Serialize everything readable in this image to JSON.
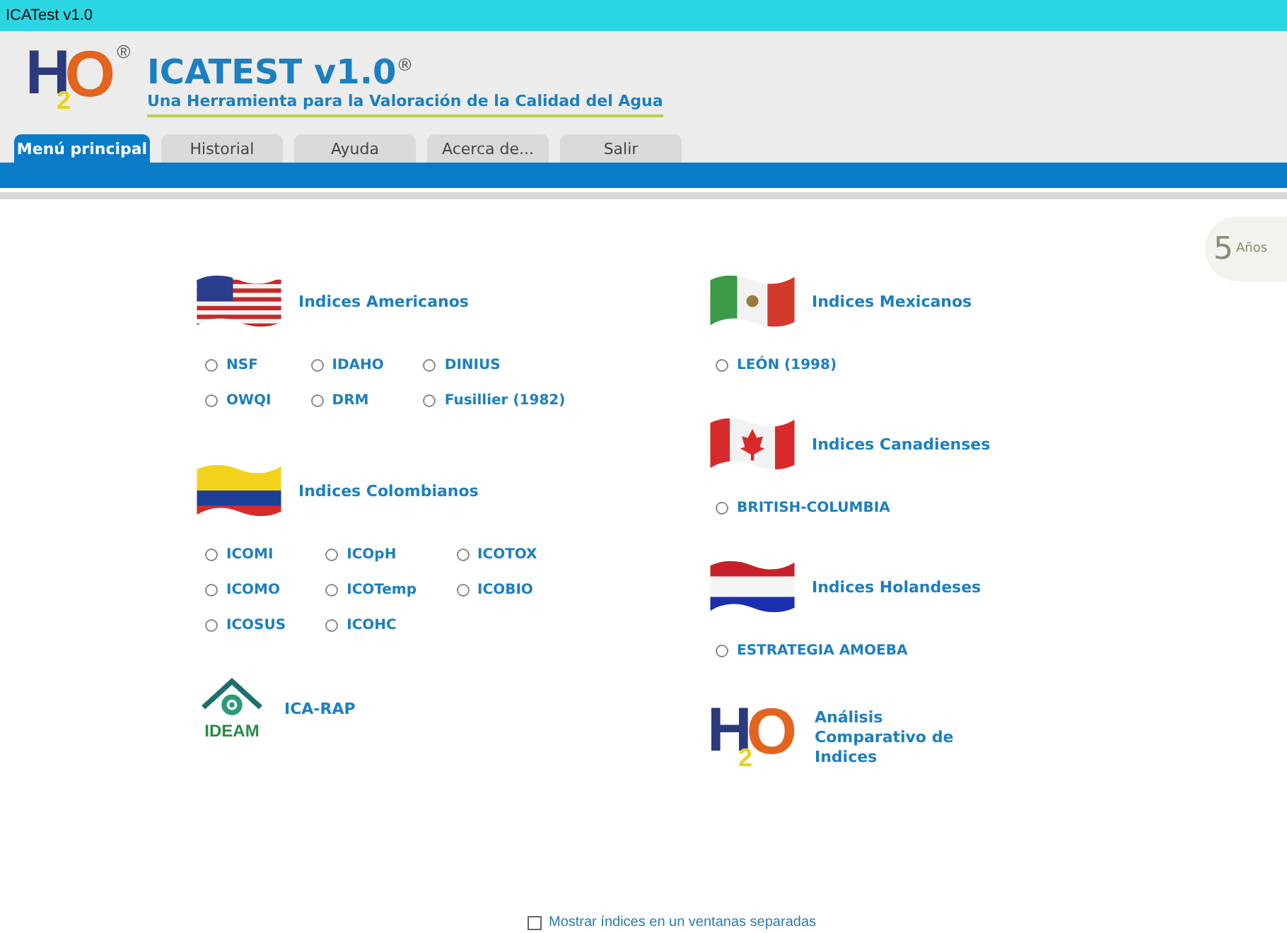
{
  "window": {
    "title": "ICATest v1.0"
  },
  "header": {
    "logo": {
      "h": "H",
      "sub": "2",
      "o": "O",
      "mark": "®"
    },
    "title": "ICATEST v1.0$^{®}$",
    "subtitle": "Una Herramienta para la Valoración de la Calidad del Agua"
  },
  "tabs": [
    {
      "label": "Menú principal",
      "selected": true
    },
    {
      "label": "Historial",
      "selected": false
    },
    {
      "label": "Ayuda",
      "selected": false
    },
    {
      "label": "Acerca de...",
      "selected": false
    },
    {
      "label": "Salir",
      "selected": false
    }
  ],
  "emblem": {
    "number": "5",
    "text": "Años"
  },
  "columns": [
    [
      {
        "kind": "flag_us",
        "title": "Indices Americanos",
        "options": [
          {
            "label": "NSF",
            "selected": false
          },
          {
            "label": "IDAHO",
            "selected": false
          },
          {
            "label": "DINIUS",
            "selected": false
          },
          {
            "label": "OWQI",
            "selected": false
          },
          {
            "label": "DRM",
            "selected": false
          },
          {
            "label": "Fusillier (1982)",
            "selected": false
          }
        ]
      },
      {
        "kind": "flag_co",
        "title": "Indices Colombianos",
        "options": [
          {
            "label": "ICOMI",
            "selected": false
          },
          {
            "label": "ICOpH",
            "selected": false
          },
          {
            "label": "ICOTOX",
            "selected": false
          },
          {
            "label": "ICOMO",
            "selected": false
          },
          {
            "label": "ICOTemp",
            "selected": false
          },
          {
            "label": "ICOBIO",
            "selected": false
          },
          {
            "label": "ICOSUS",
            "selected": false
          },
          {
            "label": "ICOHC",
            "selected": false
          }
        ]
      },
      {
        "kind": "ideam",
        "logo_text": "IDEAM",
        "title": "ICA-RAP"
      }
    ],
    [
      {
        "kind": "flag_mx",
        "title": "Indices Mexicanos",
        "options": [
          {
            "label": "LEÓN (1998)",
            "selected": false
          }
        ]
      },
      {
        "kind": "flag_ca",
        "title": "Indices Canadienses",
        "options": [
          {
            "label": "BRITISH-COLUMBIA",
            "selected": false
          }
        ]
      },
      {
        "kind": "flag_nl",
        "title": "Indices Holandeses",
        "options": [
          {
            "label": "ESTRATEGIA AMOEBA",
            "selected": false
          }
        ]
      },
      {
        "kind": "h2o",
        "logo": {
          "h": "H",
          "sub": "2",
          "o": "O"
        },
        "title": "Análisis Comparativo de Indices"
      }
    ]
  ],
  "separate_windows": {
    "label": "Mostrar índices en un ventanas separadas",
    "checked": false
  }
}
